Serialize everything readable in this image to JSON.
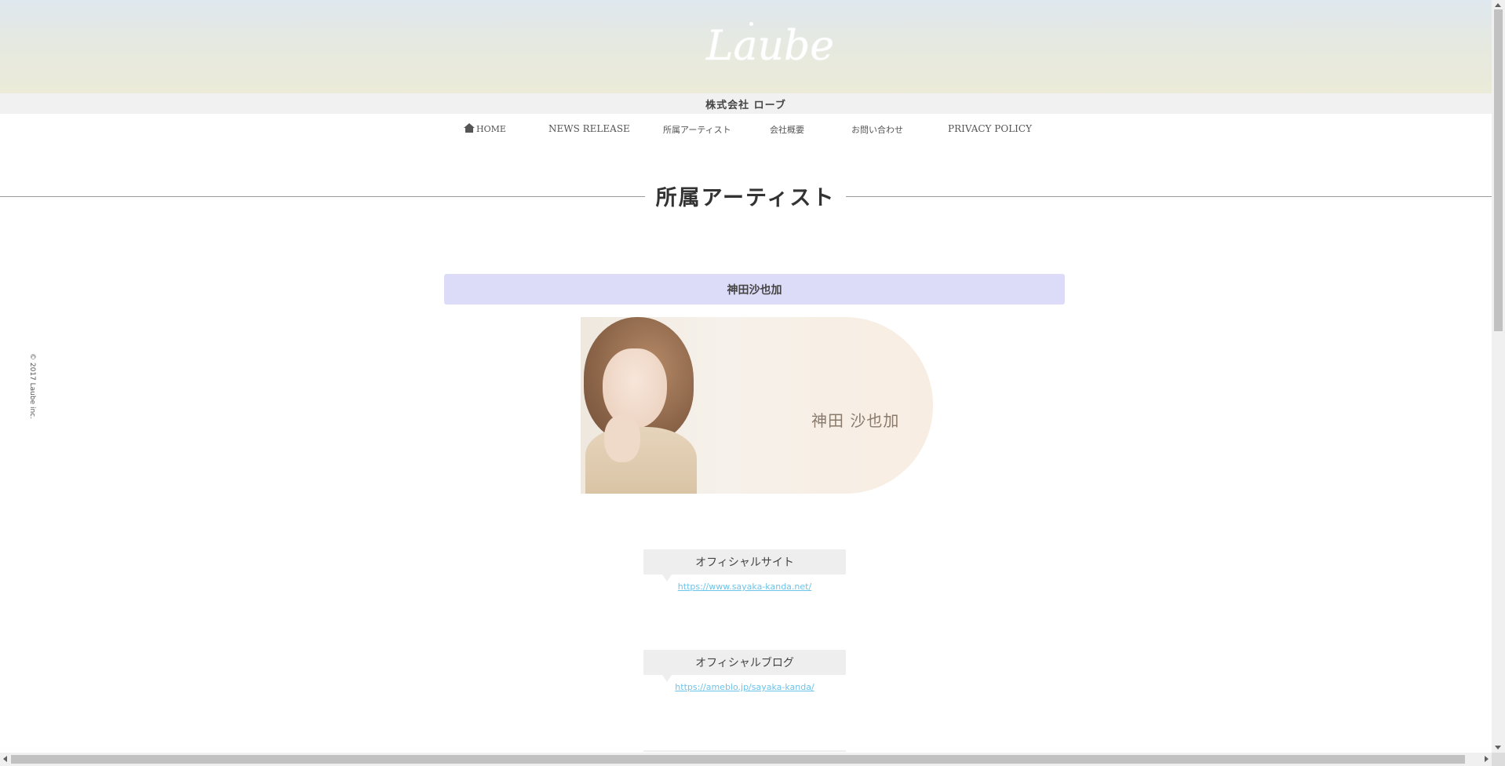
{
  "header": {
    "logo_text": "Laube",
    "company_name": "株式会社 ローブ"
  },
  "nav": {
    "items": [
      {
        "label": "HOME",
        "icon": "home-icon"
      },
      {
        "label": "NEWS RELEASE"
      },
      {
        "label": "所属アーティスト"
      },
      {
        "label": "会社概要"
      },
      {
        "label": "お問い合わせ"
      },
      {
        "label": "PRIVACY POLICY"
      }
    ]
  },
  "main": {
    "section_title": "所属アーティスト",
    "artist": {
      "name": "神田沙也加",
      "banner_name": "神田 沙也加"
    },
    "links": [
      {
        "label": "オフィシャルサイト",
        "url": "https://www.sayaka-kanda.net/"
      },
      {
        "label": "オフィシャルブログ",
        "url": "https://ameblo.jp/sayaka-kanda/"
      }
    ]
  },
  "footer": {
    "copyright": "© 2017 Laube inc."
  },
  "colors": {
    "artist_bar": "#dddcf8",
    "link": "#6cc3e8",
    "bubble": "#eeeeee"
  }
}
